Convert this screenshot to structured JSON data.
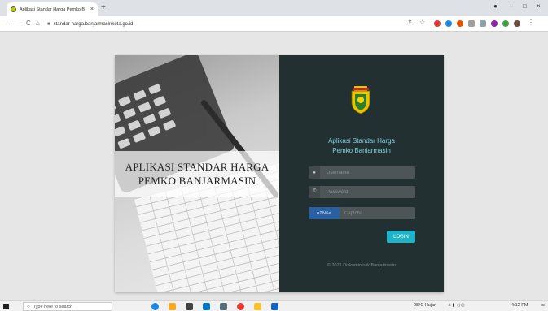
{
  "browser": {
    "tab_title": "Aplikasi Standar Harga Pemko B",
    "tab_close": "×",
    "new_tab": "+",
    "url": "standar-harga.banjarmasinkota.go.id",
    "nav_back": "←",
    "nav_forward": "→",
    "nav_reload": "C",
    "nav_home": "⌂",
    "lock": "🔒",
    "win_minimize": "–",
    "win_restore": "□",
    "win_close": "×"
  },
  "left_panel": {
    "title_line1": "APLIKASI STANDAR HARGA",
    "title_line2": "PEMKO BANJARMASIN"
  },
  "login": {
    "app_title_line1": "Aplikasi Standar Harga",
    "app_title_line2": "Pemko Banjarmasin",
    "username_placeholder": "Username",
    "password_placeholder": "Password",
    "captcha_code": "oTN6e",
    "captcha_placeholder": "Captcha",
    "login_button": "LOGIN",
    "copyright": "© 2021 Diskominfotik Banjarmasin"
  },
  "taskbar": {
    "search_placeholder": "Type here to search",
    "weather": "28°C Hujan",
    "clock": "4:12 PM"
  },
  "colors": {
    "panel_dark": "#233032",
    "accent_cyan": "#1fb3c8",
    "title_cyan": "#7fd3e0",
    "captcha_blue": "#2a5fa0"
  }
}
